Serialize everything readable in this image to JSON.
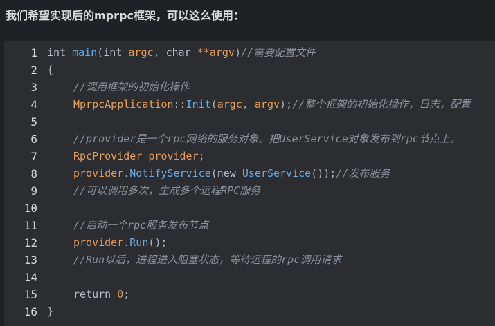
{
  "heading": "我们希望实现后的mprpc框架，可以这么使用：",
  "line_numbers": [
    "1",
    "2",
    "3",
    "4",
    "5",
    "6",
    "7",
    "8",
    "9",
    "10",
    "11",
    "12",
    "13",
    "14",
    "15",
    "16"
  ],
  "code": {
    "l1": {
      "kw_int": "int",
      "fn_main": "main",
      "p1": "(",
      "kw_int2": "int",
      "argc": "argc",
      "p2": ", ",
      "kw_char": "char",
      "stars": " **",
      "argv": "argv",
      "p3": ")",
      "comment": "//需要配置文件"
    },
    "l2": {
      "brace": "{"
    },
    "l3": {
      "comment": "//调用框架的初始化操作"
    },
    "l4": {
      "cls": "MprpcApplication",
      "sep": "::",
      "fn": "Init",
      "p1": "(",
      "argc": "argc",
      "p2": ", ",
      "argv": "argv",
      "p3": ");",
      "comment": "//整个框架的初始化操作，日志，配置"
    },
    "l5": {},
    "l6": {
      "comment": "//provider是一个rpc网络的服务对象。把UserService对象发布到rpc节点上。"
    },
    "l7": {
      "cls": "RpcProvider",
      "sp": " ",
      "var": "provider",
      "p": ";"
    },
    "l8": {
      "var": "provider",
      "dot": ".",
      "fn": "NotifyService",
      "p1": "(",
      "kw_new": "new",
      "sp": " ",
      "cls": "UserService",
      "p2": "());",
      "comment": "//发布服务"
    },
    "l9": {
      "comment": "//可以调用多次，生成多个远程RPC服务"
    },
    "l10": {},
    "l11": {
      "comment": "//启动一个rpc服务发布节点"
    },
    "l12": {
      "var": "provider",
      "dot": ".",
      "fn": "Run",
      "p": "();"
    },
    "l13": {
      "comment": "//Run以后，进程进入阻塞状态，等待远程的rpc调用请求"
    },
    "l14": {},
    "l15": {
      "kw_return": "return",
      "sp": " ",
      "num": "0",
      "p": ";"
    },
    "l16": {
      "brace": "}"
    }
  },
  "colors": {
    "background": "#1f2125",
    "code_background": "#2b2d31",
    "function": "#61afef",
    "type_or_var": "#e5a05a",
    "comment": "#8c929c"
  }
}
